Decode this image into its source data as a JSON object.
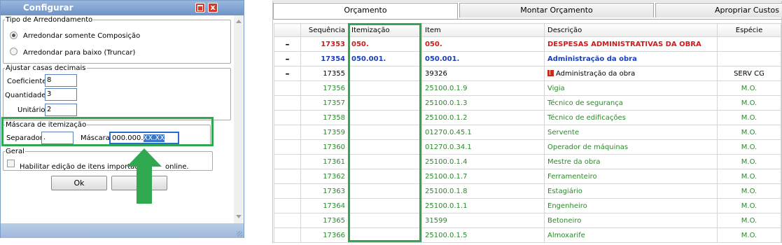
{
  "dialog": {
    "title": "Configurar",
    "close_glyph": "x",
    "rounding": {
      "legend": "Tipo de Arredondamento",
      "option1": "Arredondar somente Composição",
      "option2": "Arredondar para baixo (Truncar)"
    },
    "decimals": {
      "legend": "Ajustar casas decimais",
      "coef_label": "Coeficiente:",
      "coef_value": "8",
      "qty_label": "Quantidade:",
      "qty_value": "3",
      "unit_label": "Unitário:",
      "unit_value": "2"
    },
    "mask": {
      "legend": "Máscara de itemização",
      "sep_label": "Separador:",
      "sep_value": ".",
      "mask_label": "Máscara:",
      "mask_value_plain": "000.000.",
      "mask_value_selected": "XX.XX"
    },
    "general": {
      "legend": "Geral",
      "checkbox_label_start": "Habilitar edição de itens importados",
      "checkbox_label_end": "online."
    },
    "ok_label": "Ok",
    "second_button_label": "S"
  },
  "tabs": [
    "Orçamento",
    "Montar Orçamento",
    "Apropriar Custos"
  ],
  "table": {
    "headers": [
      "Sequência",
      "Itemização",
      "Item",
      "Descrição",
      "Espécie"
    ],
    "rows": [
      {
        "toggle": "–",
        "seq": "17353",
        "itemizacao": "050.",
        "item": "050.",
        "desc": "DESPESAS ADMINISTRATIVAS DA OBRA",
        "especie": "",
        "style": "red"
      },
      {
        "toggle": "–",
        "seq": "17354",
        "itemizacao": "050.001.",
        "item": "050.001.",
        "desc": "Administração da obra",
        "especie": "",
        "style": "blue"
      },
      {
        "toggle": "–",
        "seq": "17355",
        "itemizacao": "",
        "item": "39326",
        "desc": "Administração da obra",
        "especie": "SERV CG",
        "style": "black",
        "icon": "composition-icon"
      },
      {
        "toggle": "",
        "seq": "17356",
        "itemizacao": "",
        "item": "25100.0.1.9",
        "desc": "Vigia",
        "especie": "M.O.",
        "style": "green"
      },
      {
        "toggle": "",
        "seq": "17357",
        "itemizacao": "",
        "item": "25100.0.1.3",
        "desc": "Técnico de segurança",
        "especie": "M.O.",
        "style": "green"
      },
      {
        "toggle": "",
        "seq": "17358",
        "itemizacao": "",
        "item": "25100.0.1.2",
        "desc": "Técnico de edificações",
        "especie": "M.O.",
        "style": "green"
      },
      {
        "toggle": "",
        "seq": "17359",
        "itemizacao": "",
        "item": "01270.0.45.1",
        "desc": "Servente",
        "especie": "M.O.",
        "style": "green"
      },
      {
        "toggle": "",
        "seq": "17360",
        "itemizacao": "",
        "item": "01270.0.34.1",
        "desc": "Operador de máquinas",
        "especie": "M.O.",
        "style": "green"
      },
      {
        "toggle": "",
        "seq": "17361",
        "itemizacao": "",
        "item": "25100.0.1.4",
        "desc": "Mestre da obra",
        "especie": "M.O.",
        "style": "green"
      },
      {
        "toggle": "",
        "seq": "17362",
        "itemizacao": "",
        "item": "25100.0.1.7",
        "desc": "Ferramenteiro",
        "especie": "M.O.",
        "style": "green"
      },
      {
        "toggle": "",
        "seq": "17363",
        "itemizacao": "",
        "item": "25100.0.1.8",
        "desc": "Estagiário",
        "especie": "M.O.",
        "style": "green"
      },
      {
        "toggle": "",
        "seq": "17364",
        "itemizacao": "",
        "item": "25100.0.1.1",
        "desc": "Engenheiro",
        "especie": "M.O.",
        "style": "green"
      },
      {
        "toggle": "",
        "seq": "17365",
        "itemizacao": "",
        "item": "31599",
        "desc": "Betoneiro",
        "especie": "M.O.",
        "style": "green"
      },
      {
        "toggle": "",
        "seq": "17366",
        "itemizacao": "",
        "item": "25100.0.1.5",
        "desc": "Almoxarife",
        "especie": "M.O.",
        "style": "green"
      }
    ]
  },
  "colors": {
    "highlight": "#2fa84f",
    "red_row": "#d11a1a",
    "blue_row": "#1c3fb5",
    "green_row": "#2a8a2a"
  }
}
